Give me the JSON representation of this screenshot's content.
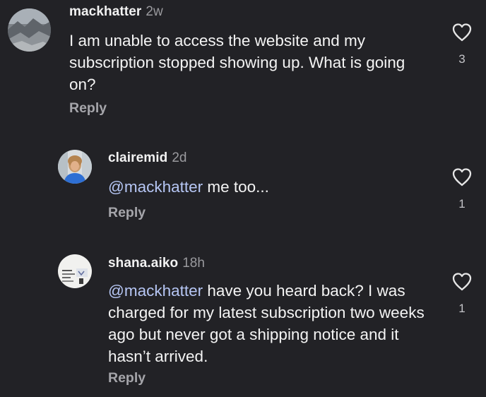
{
  "comments": [
    {
      "username": "mackhatter",
      "time": "2w",
      "text": "I am unable to access the website and my subscription stopped showing up. What is going on?",
      "reply_label": "Reply",
      "likes": "3",
      "avatar_icon": "landscape-photo"
    },
    {
      "username": "clairemid",
      "time": "2d",
      "mention": "@mackhatter",
      "text": " me too...",
      "reply_label": "Reply",
      "likes": "1",
      "avatar_icon": "person-photo"
    },
    {
      "username": "shana.aiko",
      "time": "18h",
      "mention": "@mackhatter",
      "text": " have you heard back? I was charged for my latest subscription two weeks ago but never got a shipping notice and it hasn’t arrived.",
      "reply_label": "Reply",
      "likes": "1",
      "avatar_icon": "document-photo"
    }
  ],
  "colors": {
    "background": "#222226",
    "mention": "#b6c6f4",
    "muted": "#9a9a9e"
  }
}
